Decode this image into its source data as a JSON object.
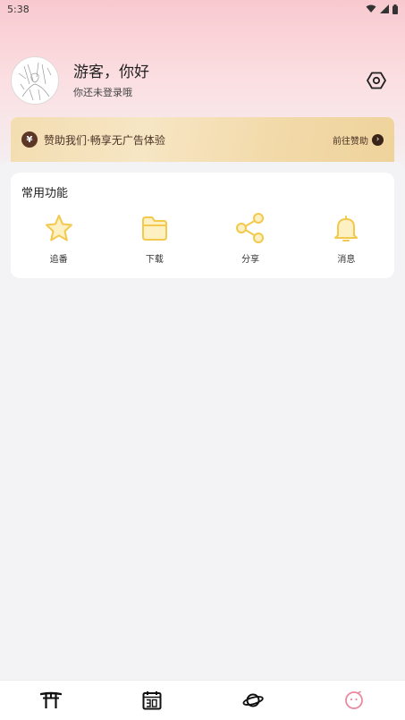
{
  "status_bar": {
    "time": "5:38"
  },
  "profile": {
    "greeting": "游客，你好",
    "login_hint": "你还未登录哦"
  },
  "sponsor": {
    "icon_text": "¥",
    "text": "赞助我们·畅享无广告体验",
    "link": "前往赞助"
  },
  "functions": {
    "title": "常用功能",
    "items": [
      {
        "label": "追番",
        "icon": "star-icon"
      },
      {
        "label": "下载",
        "icon": "folder-icon"
      },
      {
        "label": "分享",
        "icon": "share-icon"
      },
      {
        "label": "消息",
        "icon": "bell-icon"
      }
    ]
  },
  "nav": {
    "items": [
      {
        "icon": "torii-gate-icon",
        "active": false
      },
      {
        "icon": "calendar-30-icon",
        "active": false
      },
      {
        "icon": "planet-icon",
        "active": false
      },
      {
        "icon": "profile-face-icon",
        "active": true
      }
    ]
  },
  "colors": {
    "accent_yellow": "#f2c94c",
    "active_nav": "#e88aa0",
    "banner_text": "#4a3225"
  }
}
